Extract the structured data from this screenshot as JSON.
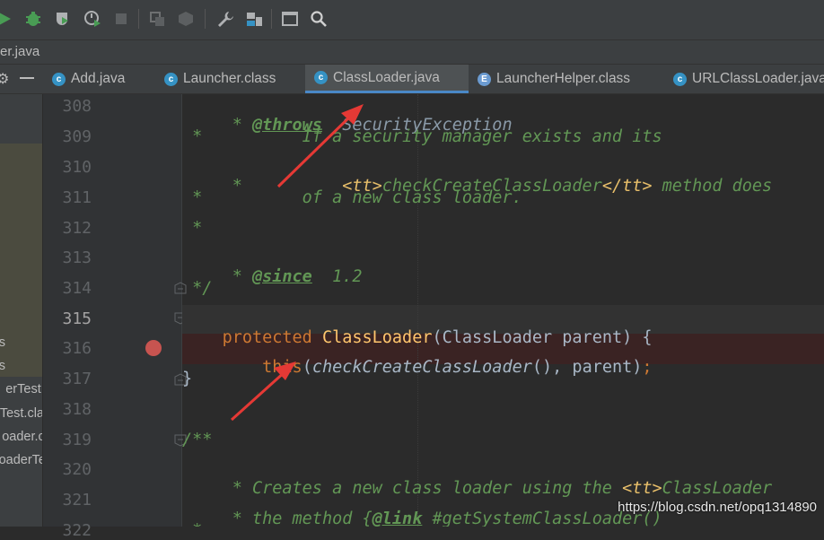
{
  "toolbar": {
    "icons": [
      "run-icon",
      "debug-icon",
      "coverage-icon",
      "profile-icon",
      "stop-icon",
      "build-icon",
      "rebuild-icon",
      "settings-icon",
      "project-structure-icon",
      "terminal-icon",
      "search-icon"
    ],
    "accent_run": "#499c54"
  },
  "path": {
    "fragment": "er.java"
  },
  "tabs": [
    {
      "label": "Add.java",
      "icon": "class-icon",
      "active": false
    },
    {
      "label": "Launcher.class",
      "icon": "class-icon",
      "active": false
    },
    {
      "label": "ClassLoader.java",
      "icon": "class-icon",
      "active": true
    },
    {
      "label": "LauncherHelper.class",
      "icon": "enum-icon",
      "active": false
    },
    {
      "label": "URLClassLoader.java",
      "icon": "class-icon",
      "active": false
    }
  ],
  "sidebar": {
    "items": [
      "s",
      "s",
      "erTest.c",
      "Test.cla",
      "oader.cl",
      "oaderTe"
    ]
  },
  "editor": {
    "line_numbers": [
      "308",
      "309",
      "310",
      "311",
      "312",
      "313",
      "314",
      "315",
      "316",
      "317",
      "318",
      "319",
      "320",
      "321",
      "322"
    ],
    "current_line": "315",
    "breakpoint_line": "316",
    "lines": {
      "l308": {
        "star": " * ",
        "tag": "@throws",
        "sp": "  ",
        "ref": "SecurityException"
      },
      "l309": {
        "text": " *          If a security manager exists and its"
      },
      "l310": {
        "star": " *          ",
        "open": "<tt>",
        "mid": "checkCreateClassLoader",
        "close": "</tt>",
        "rest": " method does"
      },
      "l311": {
        "text": " *          of a new class loader."
      },
      "l312": {
        "text": " *"
      },
      "l313": {
        "star": " * ",
        "tag": "@since",
        "rest": "  1.2"
      },
      "l314": {
        "text": " */"
      },
      "l315": {
        "kw": "protected ",
        "cls": "ClassLoader",
        "rest": "(ClassLoader parent) {"
      },
      "l316": {
        "indent": "    ",
        "kw": "this",
        "open": "(",
        "call": "checkCreateClassLoader",
        "mid": "(), parent)",
        "semi": ";"
      },
      "l317": {
        "text": "}"
      },
      "l318": {
        "text": ""
      },
      "l319": {
        "text": "/**"
      },
      "l320": {
        "pre": " * Creates a new class loader using the ",
        "html": "<tt>",
        "post": "ClassLoader"
      },
      "l321": {
        "pre": " * the method {",
        "tag": "@link",
        "post": " #getSystemClassLoader()"
      },
      "l322": {
        "text": " * "
      }
    }
  },
  "watermark": "https://blog.csdn.net/opq1314890",
  "colors": {
    "comment": "#629755",
    "keyword": "#cc7832",
    "method_decl": "#ffc66d",
    "annotation_arrow": "#e53935",
    "breakpoint": "#c75450"
  }
}
